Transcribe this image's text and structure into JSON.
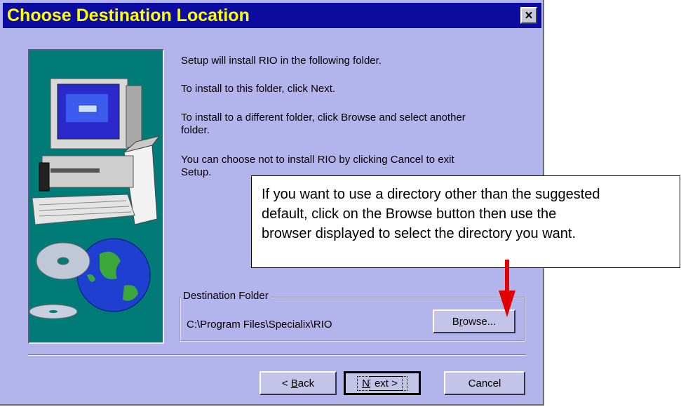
{
  "dialog": {
    "title": "Choose Destination Location",
    "close_symbol": "×"
  },
  "messages": {
    "line1": "Setup will install RIO in the following folder.",
    "line2": "To install to this folder, click Next.",
    "line3a": "To install to a different folder, click Browse and select another",
    "line3b": "folder.",
    "line4a": "You can choose not to install RIO by clicking Cancel to exit",
    "line4b": "Setup."
  },
  "destination": {
    "legend": "Destination Folder",
    "path": "C:\\Program Files\\Specialix\\RIO",
    "browse_prefix": "B",
    "browse_mnemonic": "r",
    "browse_suffix": "owse..."
  },
  "buttons": {
    "back_prefix": "< ",
    "back_mnemonic": "B",
    "back_suffix": "ack",
    "next_mnemonic": "N",
    "next_suffix": "ext >",
    "cancel": "Cancel"
  },
  "callout": {
    "line1": "If you want to use a directory other than the suggested",
    "line2": "default, click on the Browse button then use the",
    "line3": "browser displayed to select the directory you want."
  },
  "colors": {
    "dialog_bg": "#b4b4ec",
    "titlebar": "#0c0ca0",
    "title_text": "#ffff00",
    "arrow": "#e00000",
    "illustration_bg": "#007b78"
  },
  "icons": {
    "illustration": "computer-and-globe-illustration",
    "close": "close-icon",
    "arrow": "down-arrow-icon"
  }
}
